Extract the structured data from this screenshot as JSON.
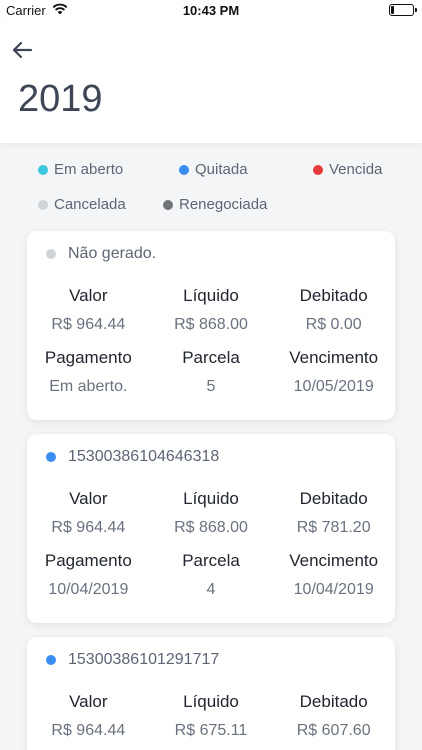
{
  "status": {
    "carrier": "Carrier",
    "time": "10:43 PM",
    "battery_level": 0.15
  },
  "header": {
    "title": "2019"
  },
  "legend": [
    {
      "label": "Em aberto",
      "color": "#3dc6dc"
    },
    {
      "label": "Quitada",
      "color": "#3a8ef0"
    },
    {
      "label": "Vencida",
      "color": "#e53b3b"
    },
    {
      "label": "Cancelada",
      "color": "#d0d3d8"
    },
    {
      "label": "Renegociada",
      "color": "#707378"
    }
  ],
  "labels": {
    "valor": "Valor",
    "liquido": "Líquido",
    "debitado": "Debitado",
    "pagamento": "Pagamento",
    "parcela": "Parcela",
    "vencimento": "Vencimento"
  },
  "cards": [
    {
      "id": "Não gerado.",
      "dot_color": "#d0d3d8",
      "valor": "R$ 964.44",
      "liquido": "R$ 868.00",
      "debitado": "R$ 0.00",
      "pagamento": "Em aberto.",
      "parcela": "5",
      "vencimento": "10/05/2019"
    },
    {
      "id": "15300386104646318",
      "dot_color": "#3a8ef0",
      "valor": "R$ 964.44",
      "liquido": "R$ 868.00",
      "debitado": "R$ 781.20",
      "pagamento": "10/04/2019",
      "parcela": "4",
      "vencimento": "10/04/2019"
    },
    {
      "id": "15300386101291717",
      "dot_color": "#3a8ef0",
      "valor": "R$ 964.44",
      "liquido": "R$ 675.11",
      "debitado": "R$ 607.60",
      "pagamento": "",
      "parcela": "",
      "vencimento": ""
    }
  ]
}
